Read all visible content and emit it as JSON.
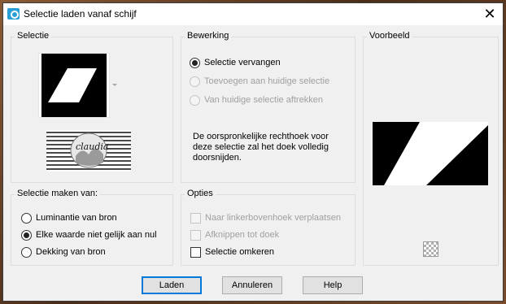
{
  "window": {
    "title": "Selectie laden vanaf schijf",
    "close_glyph": "✕"
  },
  "selectie": {
    "label": "Selectie",
    "logo_text": "claudia"
  },
  "bewerking": {
    "label": "Bewerking",
    "options": [
      {
        "label": "Selectie vervangen",
        "checked": true,
        "disabled": false
      },
      {
        "label": "Toevoegen aan huidige selectie",
        "checked": false,
        "disabled": true
      },
      {
        "label": "Van huidige selectie aftrekken",
        "checked": false,
        "disabled": true
      }
    ],
    "description": "De oorspronkelijke rechthoek voor deze selectie zal het doek volledig doorsnijden."
  },
  "voorbeeld": {
    "label": "Voorbeeld"
  },
  "maken": {
    "label": "Selectie maken van:",
    "options": [
      {
        "label": "Luminantie van bron",
        "checked": false
      },
      {
        "label": "Elke waarde niet gelijk aan nul",
        "checked": true
      },
      {
        "label": "Dekking van bron",
        "checked": false
      }
    ]
  },
  "opties": {
    "label": "Opties",
    "options": [
      {
        "label": "Naar linkerbovenhoek verplaatsen",
        "checked": false,
        "disabled": true
      },
      {
        "label": "Afknippen tot doek",
        "checked": false,
        "disabled": true
      },
      {
        "label": "Selectie omkeren",
        "checked": false,
        "disabled": false
      }
    ]
  },
  "buttons": {
    "ok": "Laden",
    "cancel": "Annuleren",
    "help": "Help"
  },
  "icons": {
    "app": "app-icon",
    "close": "close-icon",
    "transparency": "transparency-toggle-icon",
    "dropdown": "dropdown-arrow-icon"
  }
}
